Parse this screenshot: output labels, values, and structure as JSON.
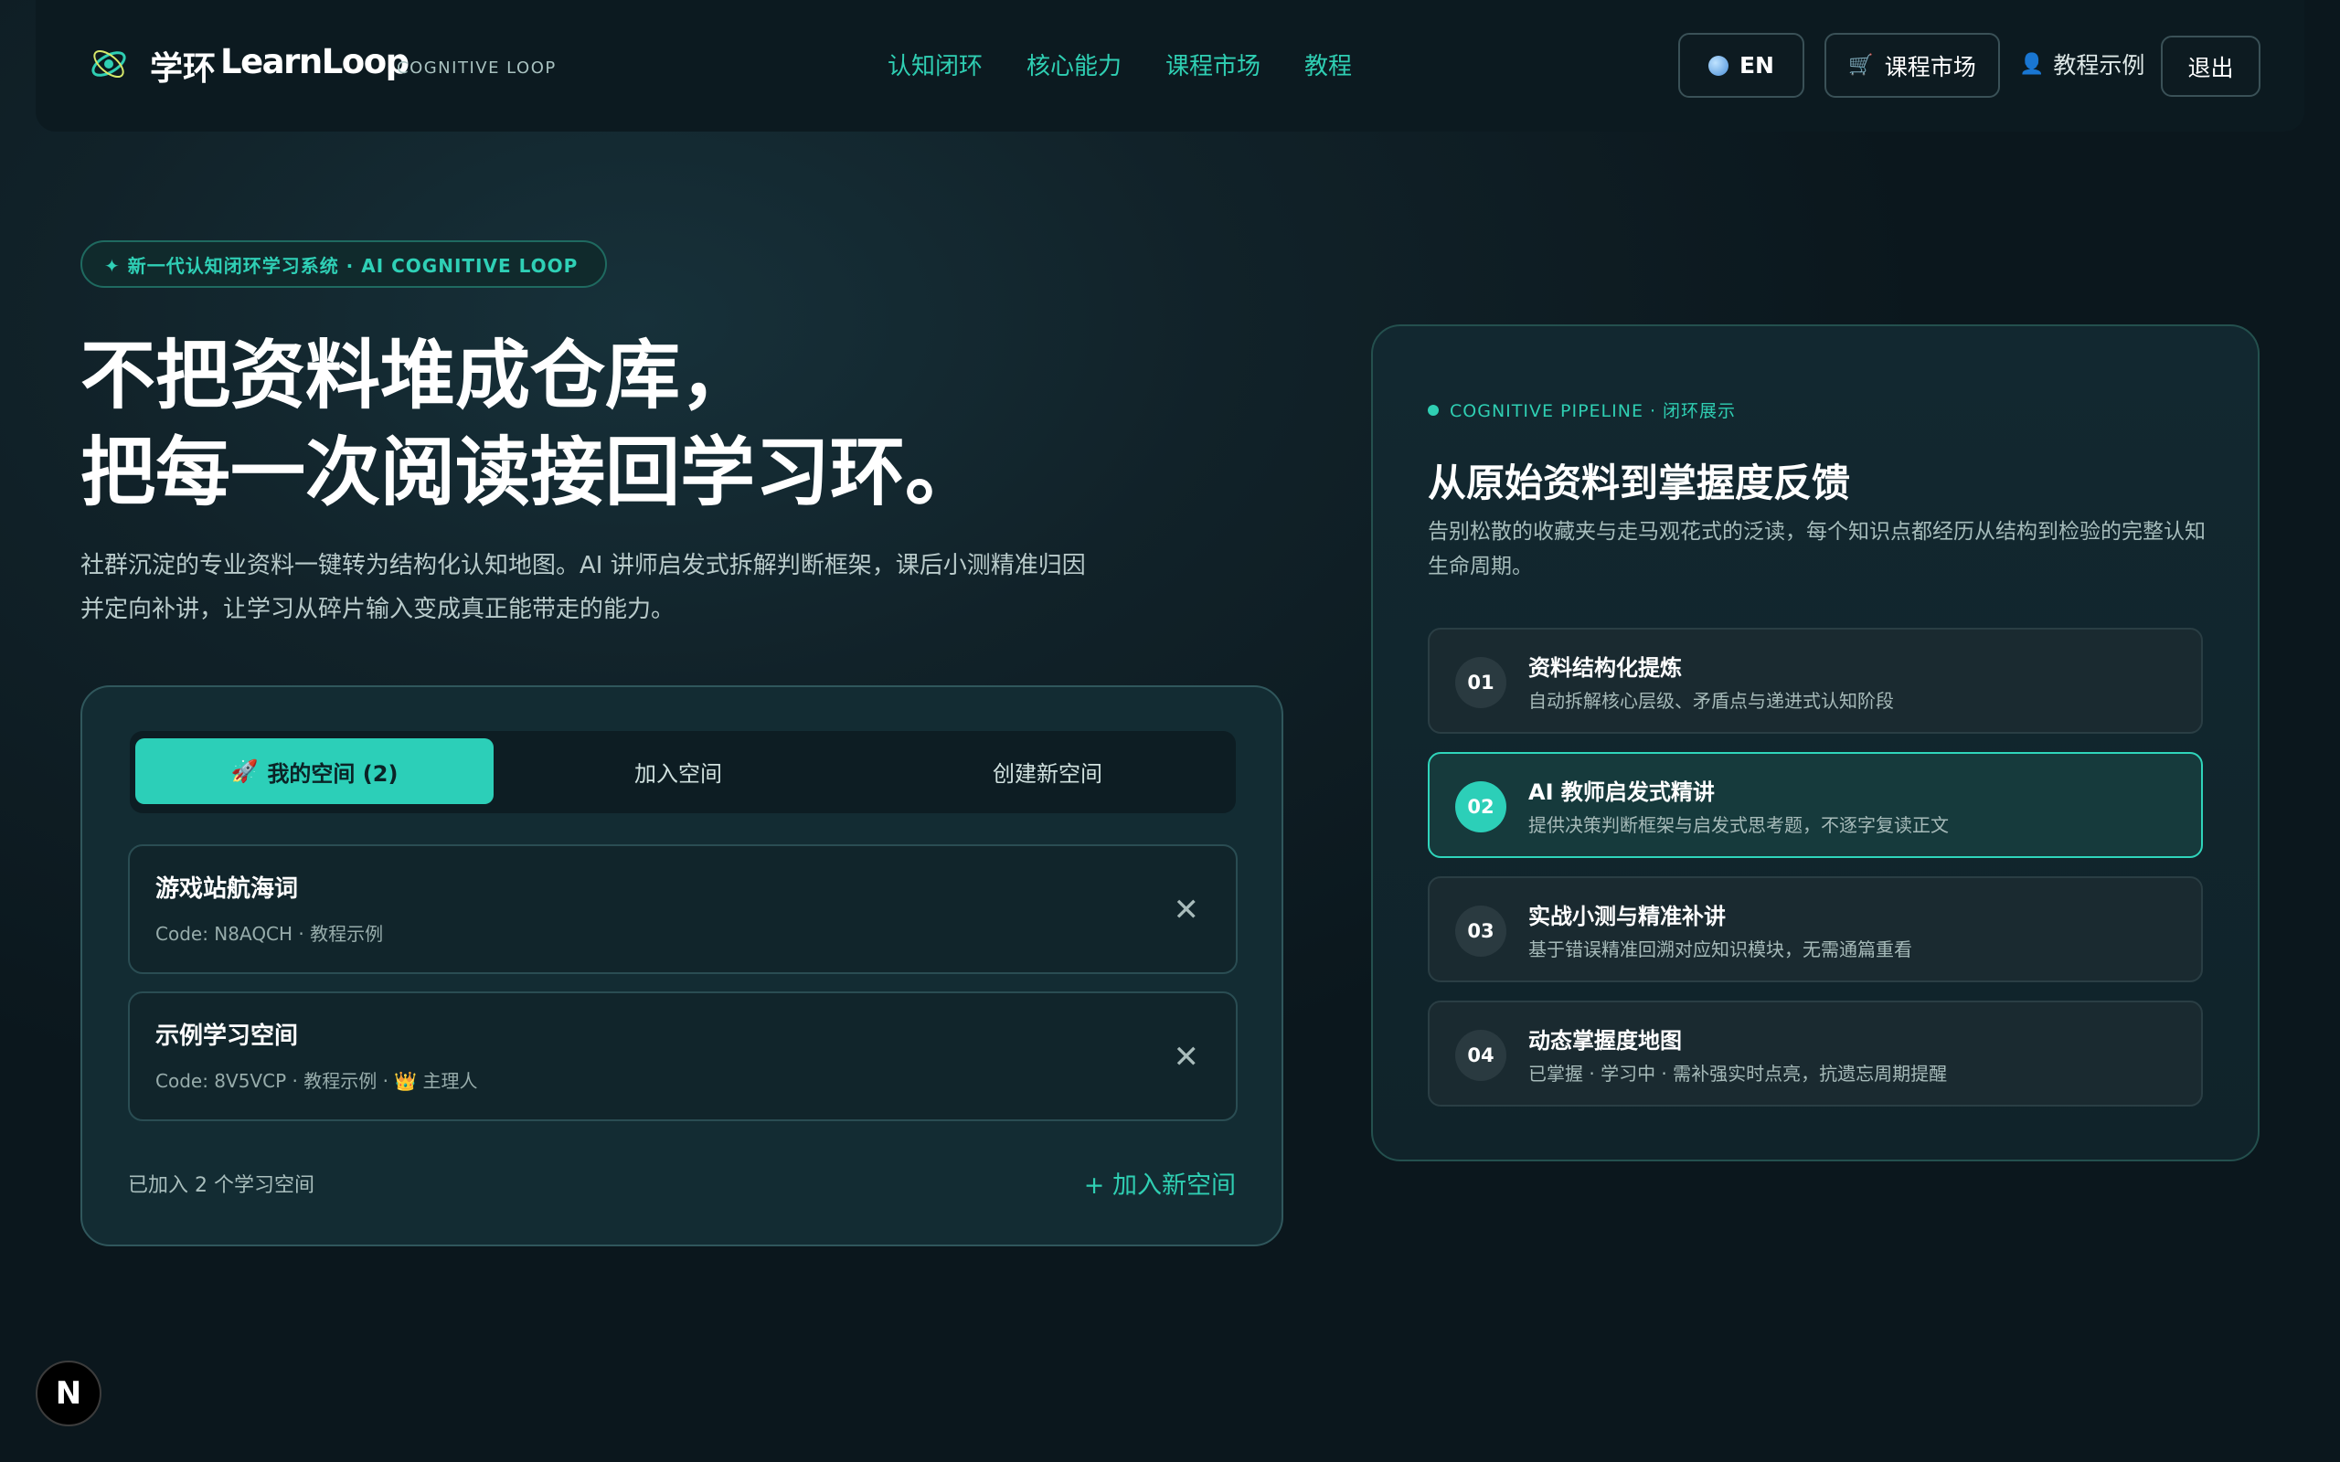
{
  "header": {
    "brand_cn": "学环",
    "brand_en": "LearnLoop",
    "brand_sub": "COGNITIVE LOOP",
    "nav": [
      "认知闭环",
      "核心能力",
      "课程市场",
      "教程"
    ],
    "lang_button": "EN",
    "market_button": "课程市场",
    "demo_link": "教程示例",
    "logout_button": "退出"
  },
  "hero": {
    "badge": "✦ 新一代认知闭环学习系统 · AI COGNITIVE LOOP",
    "title_line1": "不把资料堆成仓库，",
    "title_line2": "把每一次阅读接回学习环。",
    "desc": "社群沉淀的专业资料一键转为结构化认知地图。AI 讲师启发式拆解判断框架，课后小测精准归因并定向补讲，让学习从碎片输入变成真正能带走的能力。"
  },
  "spaces": {
    "tabs": [
      "我的空间 (2)",
      "加入空间",
      "创建新空间"
    ],
    "active_tab_icon": "🚀",
    "items": [
      {
        "name": "游戏站航海词",
        "meta": "Code: N8AQCH · 教程示例",
        "owner": ""
      },
      {
        "name": "示例学习空间",
        "meta": "Code: 8V5VCP · 教程示例 · ",
        "owner": "👑 主理人"
      }
    ],
    "joined_count": "已加入 2 个学习空间",
    "join_new": "+ 加入新空间"
  },
  "pipeline": {
    "label": "COGNITIVE PIPELINE · 闭环展示",
    "title": "从原始资料到掌握度反馈",
    "desc": "告别松散的收藏夹与走马观花式的泛读，每个知识点都经历从结构到检验的完整认知生命周期。",
    "steps": [
      {
        "num": "01",
        "title": "资料结构化提炼",
        "desc": "自动拆解核心层级、矛盾点与递进式认知阶段"
      },
      {
        "num": "02",
        "title": "AI 教师启发式精讲",
        "desc": "提供决策判断框架与启发式思考题，不逐字复读正文"
      },
      {
        "num": "03",
        "title": "实战小测与精准补讲",
        "desc": "基于错误精准回溯对应知识模块，无需通篇重看"
      },
      {
        "num": "04",
        "title": "动态掌握度地图",
        "desc": "已掌握 · 学习中 · 需补强实时点亮，抗遗忘周期提醒"
      }
    ]
  },
  "misc": {
    "n_badge": "N",
    "accent_color": "#2fcfb3"
  }
}
